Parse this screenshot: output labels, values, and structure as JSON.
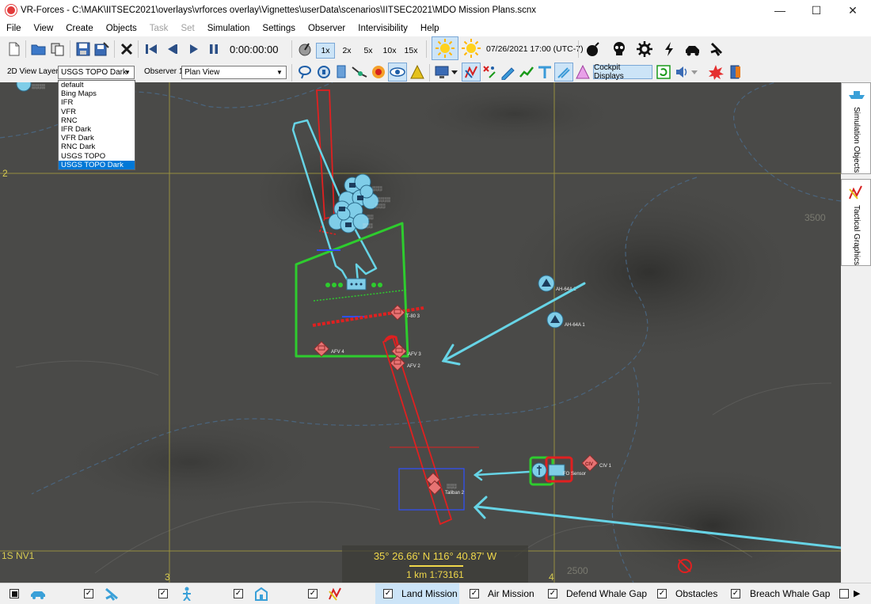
{
  "window": {
    "title": "VR-Forces - C:\\MAK\\IITSEC2021\\overlays\\vrforces overlay\\Vignettes\\userData\\scenarios\\IITSEC2021\\MDO Mission Plans.scnx",
    "minimize": "—",
    "maximize": "☐",
    "close": "✕"
  },
  "menu": {
    "file": "File",
    "view": "View",
    "create": "Create",
    "objects": "Objects",
    "task": "Task",
    "set": "Set",
    "simulation": "Simulation",
    "settings": "Settings",
    "observer": "Observer",
    "intervisibility": "Intervisibility",
    "help": "Help"
  },
  "toolbar": {
    "sim_time": "0:00:00:00",
    "speeds": [
      "1x",
      "2x",
      "5x",
      "10x",
      "15x"
    ],
    "active_speed": "1x",
    "datetime": "07/26/2021 17:00 (UTC-7)",
    "view_layer_label": "2D View Layer:",
    "view_layer_value": "USGS TOPO Dark",
    "observer_label": "Observer 1",
    "observer_value": "Plan View",
    "cockpit_displays": "Cockpit Displays"
  },
  "layer_options": [
    "default",
    "Bing Maps",
    "IFR",
    "VFR",
    "RNC",
    "IFR Dark",
    "VFR Dark",
    "RNC Dark",
    "USGS TOPO",
    "USGS TOPO Dark"
  ],
  "selected_layer": "USGS TOPO Dark",
  "side_tabs": {
    "simulation_objects": "Simulation Objects",
    "tactical_graphics": "Tactical Graphics"
  },
  "map": {
    "grid_labels": {
      "row_2": "2",
      "col_3": "3",
      "col_4": "4",
      "zone": "1S NV1"
    },
    "contour_labels": [
      "3500",
      "2500"
    ],
    "units": {
      "ah64a_2": "AH-64A 2",
      "ah64a_1": "AH-64A 1",
      "t80_3": "T-80 3",
      "afv_4": "AFV 4",
      "afv_3": "AFV 3",
      "afv_2": "AFV 2",
      "civ_1": "CIV 1",
      "fo_sensor": "FO Sensor",
      "taliban_2": "Taliban 2"
    },
    "colors": {
      "friendly": "#7fcde8",
      "hostile": "#e77373",
      "route_cyan": "#67d4e6",
      "red_graphic": "#e02020",
      "green_graphic": "#2ecc2e"
    }
  },
  "coordinates": {
    "latlon": "35° 26.66' N  116° 40.87' W",
    "scale": "1 km   1:73161"
  },
  "statusbar": {
    "layers": [
      {
        "label": "",
        "checked": true
      },
      {
        "label": "",
        "checked": true
      },
      {
        "label": "",
        "checked": true
      },
      {
        "label": "",
        "checked": true
      },
      {
        "label": "",
        "checked": true
      },
      {
        "label": "Land Mission",
        "checked": true
      },
      {
        "label": "Air Mission",
        "checked": true
      },
      {
        "label": "Defend Whale Gap",
        "checked": true
      },
      {
        "label": "Obstacles",
        "checked": true
      },
      {
        "label": "Breach Whale Gap",
        "checked": true
      }
    ]
  }
}
